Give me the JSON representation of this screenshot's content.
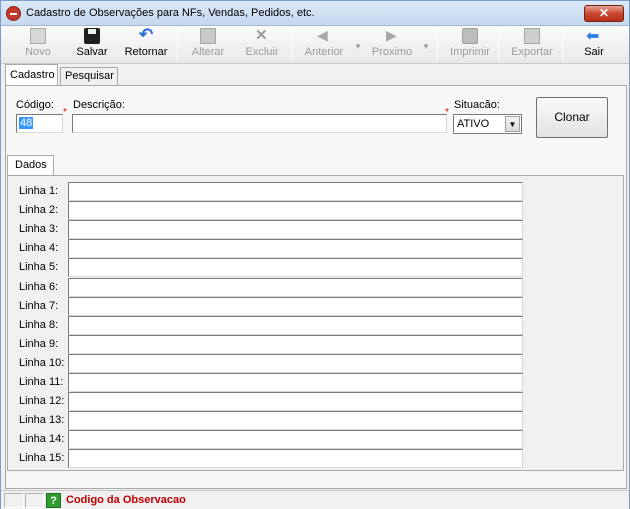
{
  "window": {
    "title": "Cadastro de Observações para NFs, Vendas, Pedidos, etc.",
    "close_label": "✕"
  },
  "toolbar": {
    "novo": "Novo",
    "salvar": "Salvar",
    "retornar": "Retornar",
    "alterar": "Alterar",
    "excluir": "Excluir",
    "anterior": "Anterior",
    "proximo": "Proximo",
    "imprimir": "Imprimir",
    "exportar": "Exportar",
    "sair": "Sair",
    "dropdown_arrow": "▼"
  },
  "tabs": {
    "cadastro": "Cadastro",
    "pesquisar": "Pesquisar"
  },
  "form": {
    "codigo_label": "Código:",
    "codigo_value": "48",
    "required_mark": "*",
    "descricao_label": "Descrição:",
    "descricao_value": "",
    "situacao_label": "Situacão:",
    "situacao_value": "ATIVO",
    "clonar_label": "Clonar"
  },
  "dados": {
    "tab_label": "Dados",
    "lines": [
      {
        "label": "Linha 1:",
        "value": ""
      },
      {
        "label": "Linha 2:",
        "value": ""
      },
      {
        "label": "Linha 3:",
        "value": ""
      },
      {
        "label": "Linha 4:",
        "value": ""
      },
      {
        "label": "Linha 5:",
        "value": ""
      },
      {
        "label": "Linha 6:",
        "value": ""
      },
      {
        "label": "Linha 7:",
        "value": ""
      },
      {
        "label": "Linha 8:",
        "value": ""
      },
      {
        "label": "Linha 9:",
        "value": ""
      },
      {
        "label": "Linha 10:",
        "value": ""
      },
      {
        "label": "Linha 11:",
        "value": ""
      },
      {
        "label": "Linha 12:",
        "value": ""
      },
      {
        "label": "Linha 13:",
        "value": ""
      },
      {
        "label": "Linha 14:",
        "value": ""
      },
      {
        "label": "Linha 15:",
        "value": ""
      }
    ]
  },
  "status": {
    "help_icon": "?",
    "text": "Codigo da Observacao"
  }
}
